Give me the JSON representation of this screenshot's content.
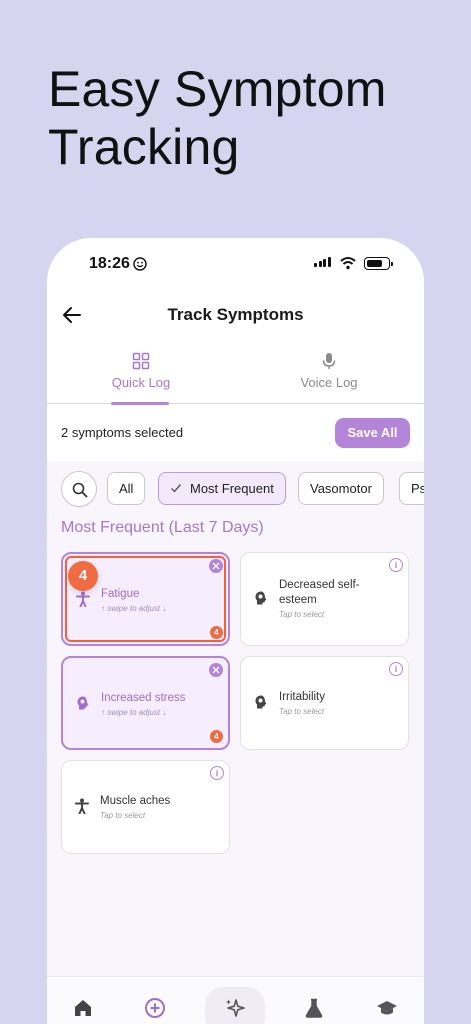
{
  "promo": {
    "headline_line1": "Easy Symptom",
    "headline_line2": "Tracking"
  },
  "status_bar": {
    "time": "18:26"
  },
  "app_bar": {
    "title": "Track Symptoms"
  },
  "tabs": [
    {
      "label": "Quick Log",
      "icon": "grid-icon",
      "active": true
    },
    {
      "label": "Voice Log",
      "icon": "microphone-icon",
      "active": false
    }
  ],
  "selection": {
    "count_text": "2 symptoms selected",
    "save_label": "Save All"
  },
  "filters": {
    "chips": [
      "All",
      "Most Frequent",
      "Vasomotor",
      "Ps"
    ],
    "active": "Most Frequent"
  },
  "section": {
    "title": "Most Frequent (Last 7 Days)"
  },
  "symptoms": [
    {
      "name": "Fatigue",
      "hint": "↑ swipe to adjust ↓",
      "selected": true,
      "severity": "4",
      "icon": "person-icon"
    },
    {
      "name": "Decreased self-esteem",
      "hint": "Tap to select",
      "selected": false,
      "icon": "head-icon"
    },
    {
      "name": "Increased stress",
      "hint": "↑ swipe to adjust ↓",
      "selected": true,
      "severity": "4",
      "icon": "head-icon"
    },
    {
      "name": "Irritability",
      "hint": "Tap to select",
      "selected": false,
      "icon": "head-icon"
    },
    {
      "name": "Muscle aches",
      "hint": "Tap to select",
      "selected": false,
      "icon": "person-icon"
    }
  ],
  "tooltip_badge": "4",
  "colors": {
    "accent": "#b384d8",
    "severity": "#f06a42",
    "background": "#d6d4ef"
  },
  "bottom_nav": [
    "home-icon",
    "add-circle-icon",
    "sparkle-icon",
    "flask-icon",
    "graduation-cap-icon"
  ]
}
